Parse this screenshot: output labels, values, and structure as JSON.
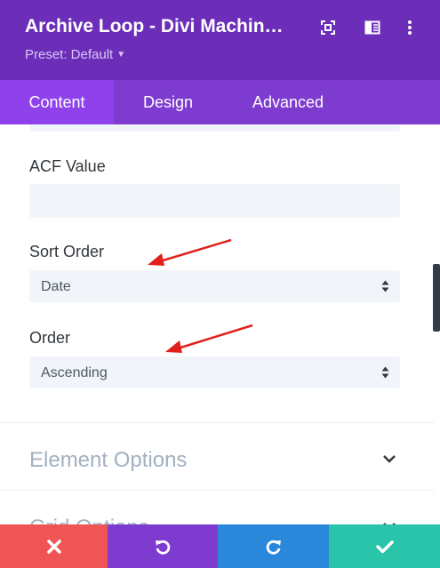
{
  "header": {
    "title": "Archive Loop - Divi Machin…",
    "preset_label": "Preset: Default",
    "icons": [
      "focus-icon",
      "columns-icon",
      "more-vert-icon"
    ]
  },
  "tabs": [
    {
      "label": "Content",
      "active": true
    },
    {
      "label": "Design",
      "active": false
    },
    {
      "label": "Advanced",
      "active": false
    }
  ],
  "fields": {
    "acf_value": {
      "label": "ACF Value",
      "value": ""
    },
    "sort_order": {
      "label": "Sort Order",
      "value": "Date"
    },
    "order": {
      "label": "Order",
      "value": "Ascending"
    }
  },
  "toggles": [
    {
      "label": "Element Options",
      "icon": "chevron-down-icon"
    },
    {
      "label": "Grid Options",
      "icon": "chevron-down-icon"
    }
  ],
  "bottom_bar": {
    "buttons": [
      {
        "name": "cancel",
        "icon": "close-icon",
        "color": "#ef5555"
      },
      {
        "name": "undo",
        "icon": "undo-icon",
        "color": "#7e3bd0"
      },
      {
        "name": "redo",
        "icon": "redo-icon",
        "color": "#2b87da"
      },
      {
        "name": "save",
        "icon": "check-icon",
        "color": "#29c4a9"
      }
    ]
  },
  "colors": {
    "header_bg": "#6c2eb9",
    "tabs_bg": "#7e3bd0",
    "active_tab_bg": "#8f42ec",
    "annotation_arrow": "#e0201c"
  }
}
